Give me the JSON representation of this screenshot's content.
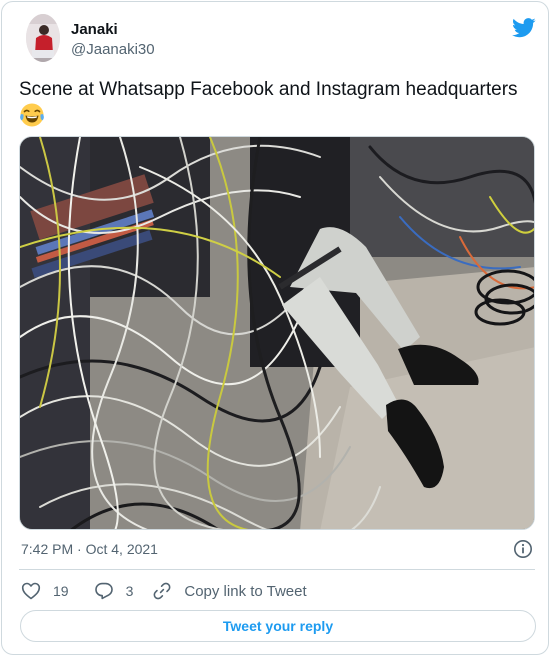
{
  "author": {
    "name": "Janaki",
    "handle": "@Jaanaki30"
  },
  "tweet": {
    "text": "Scene at Whatsapp Facebook and Instagram headquarters",
    "emoji": "face-with-tears-of-joy-icon",
    "timestamp": "7:42 PM · Oct 4, 2021"
  },
  "actions": {
    "like_count": "19",
    "reply_count": "3",
    "copy_label": "Copy link to Tweet"
  },
  "reply_button_label": "Tweet your reply",
  "colors": {
    "accent": "#1d9bf0",
    "text": "#0f1419",
    "secondary": "#536471",
    "border": "#cfd9de"
  }
}
